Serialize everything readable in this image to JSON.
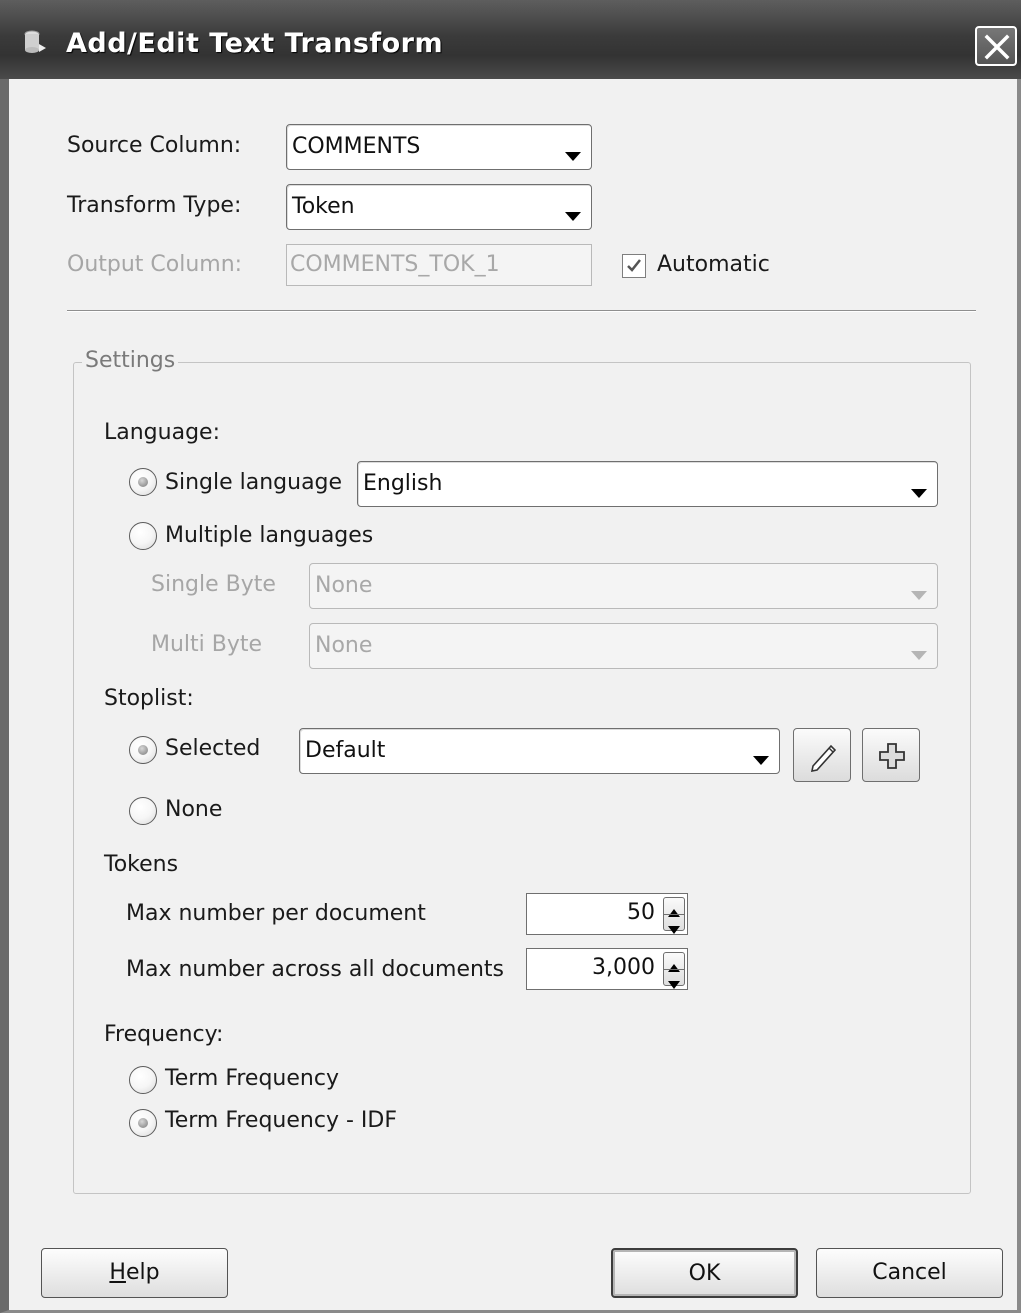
{
  "window": {
    "title": "Add/Edit Text Transform"
  },
  "fields": {
    "source_column": {
      "label": "Source Column:",
      "value": "COMMENTS"
    },
    "transform_type": {
      "label": "Transform Type:",
      "value": "Token"
    },
    "output_column": {
      "label": "Output Column:",
      "value": "COMMENTS_TOK_1",
      "disabled": true
    },
    "automatic": {
      "label": "Automatic",
      "checked": true
    }
  },
  "settings": {
    "title": "Settings",
    "language": {
      "label": "Language:",
      "single": {
        "label": "Single language",
        "selected": true,
        "value": "English"
      },
      "multiple": {
        "label": "Multiple languages",
        "selected": false
      },
      "single_byte": {
        "label": "Single Byte",
        "value": "None",
        "disabled": true
      },
      "multi_byte": {
        "label": "Multi Byte",
        "value": "None",
        "disabled": true
      }
    },
    "stoplist": {
      "label": "Stoplist:",
      "selected": {
        "label": "Selected",
        "selected": true,
        "value": "Default"
      },
      "none": {
        "label": "None",
        "selected": false
      },
      "edit_icon": "pencil-icon",
      "add_icon": "plus-icon"
    },
    "tokens": {
      "label": "Tokens",
      "max_per_document": {
        "label": "Max number per document",
        "value": "50"
      },
      "max_across_documents": {
        "label": "Max number across all documents",
        "value": "3,000"
      }
    },
    "frequency": {
      "label": "Frequency:",
      "term_frequency": {
        "label": "Term Frequency",
        "selected": false
      },
      "term_frequency_idf": {
        "label": "Term Frequency - IDF",
        "selected": true
      }
    }
  },
  "buttons": {
    "help_prefix": "H",
    "help_rest": "elp",
    "ok": "OK",
    "cancel": "Cancel"
  }
}
